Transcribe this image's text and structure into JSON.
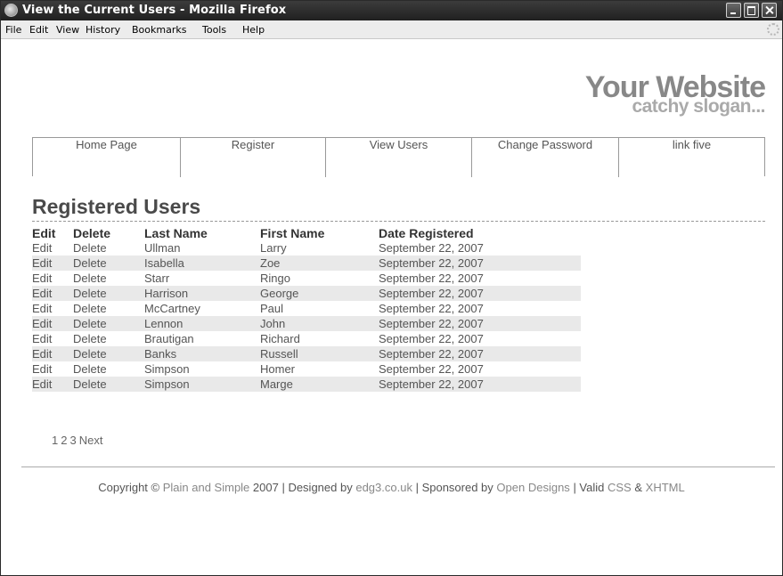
{
  "window": {
    "title": "View the Current Users - Mozilla Firefox"
  },
  "menu": [
    "File",
    "Edit",
    "View",
    "History",
    "Bookmarks",
    "Tools",
    "Help"
  ],
  "site": {
    "logo": "Your Website",
    "slogan": "catchy slogan..."
  },
  "nav": [
    "Home Page",
    "Register",
    "View Users",
    "Change Password",
    "link five"
  ],
  "page": {
    "title": "Registered Users"
  },
  "table": {
    "headers": [
      "Edit",
      "Delete",
      "Last Name",
      "First Name",
      "Date Registered"
    ],
    "rows": [
      [
        "Edit",
        "Delete",
        "Ullman",
        "Larry",
        "September 22, 2007"
      ],
      [
        "Edit",
        "Delete",
        "Isabella",
        "Zoe",
        "September 22, 2007"
      ],
      [
        "Edit",
        "Delete",
        "Starr",
        "Ringo",
        "September 22, 2007"
      ],
      [
        "Edit",
        "Delete",
        "Harrison",
        "George",
        "September 22, 2007"
      ],
      [
        "Edit",
        "Delete",
        "McCartney",
        "Paul",
        "September 22, 2007"
      ],
      [
        "Edit",
        "Delete",
        "Lennon",
        "John",
        "September 22, 2007"
      ],
      [
        "Edit",
        "Delete",
        "Brautigan",
        "Richard",
        "September 22, 2007"
      ],
      [
        "Edit",
        "Delete",
        "Banks",
        "Russell",
        "September 22, 2007"
      ],
      [
        "Edit",
        "Delete",
        "Simpson",
        "Homer",
        "September 22, 2007"
      ],
      [
        "Edit",
        "Delete",
        "Simpson",
        "Marge",
        "September 22, 2007"
      ]
    ]
  },
  "pagination": {
    "pages": [
      "1",
      "2",
      "3"
    ],
    "next": "Next"
  },
  "footer": {
    "copyright": "Copyright ©",
    "site_link": "Plain and Simple",
    "year_designed": "2007 | Designed by",
    "designer_link": "edg3.co.uk",
    "sponsored": "| Sponsored by",
    "sponsor_link": "Open Designs",
    "valid_sep": "| Valid",
    "css_link": "CSS",
    "amp": "&",
    "xhtml_link": "XHTML"
  }
}
